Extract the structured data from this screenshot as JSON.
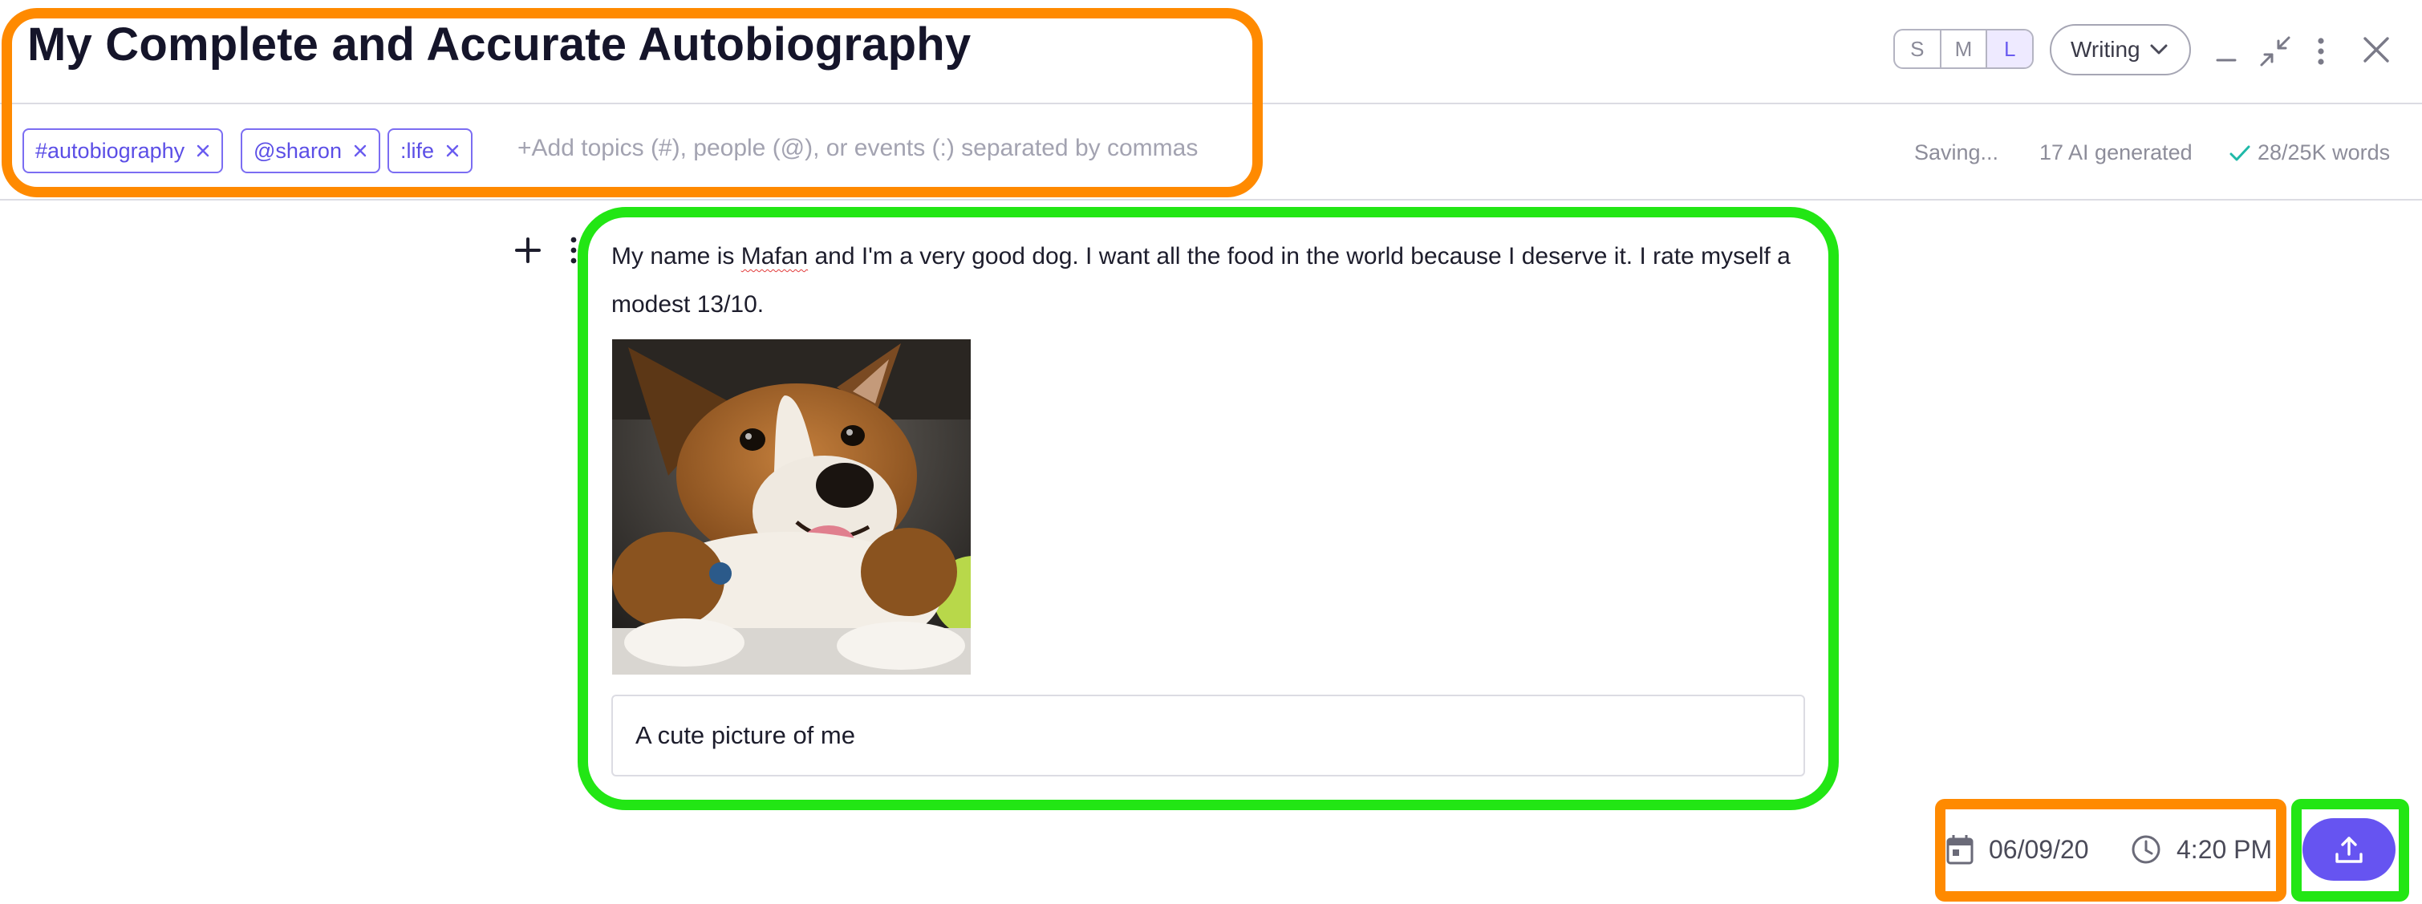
{
  "header": {
    "title": "My Complete and Accurate Autobiography",
    "size_options": [
      "S",
      "M",
      "L"
    ],
    "selected_size": "L",
    "mode": "Writing"
  },
  "window_icons": [
    "minimize-icon",
    "collapse-icon",
    "more-vertical-icon",
    "close-icon"
  ],
  "tags": [
    {
      "label": "#autobiography"
    },
    {
      "label": "@sharon"
    },
    {
      "label": ":life"
    }
  ],
  "tag_input": {
    "placeholder": "+Add topics (#), people (@), or events (:) separated by commas"
  },
  "status": {
    "saving": "Saving...",
    "ai_generated": "17 AI generated",
    "word_count": "28/25K words"
  },
  "editor": {
    "paragraph_before": "My name is ",
    "paragraph_misspelled": "Mafan",
    "paragraph_after": " and I'm a very good dog. I want all the food in the world because I deserve it. I rate myself a modest 13/10.",
    "image_alt": "corgi photo",
    "caption": "A cute picture of me"
  },
  "footer": {
    "date": "06/09/20",
    "time": "4:20 PM"
  },
  "colors": {
    "accent": "#6654f1",
    "annotation_orange": "#ff8a00",
    "annotation_green": "#22e614"
  }
}
